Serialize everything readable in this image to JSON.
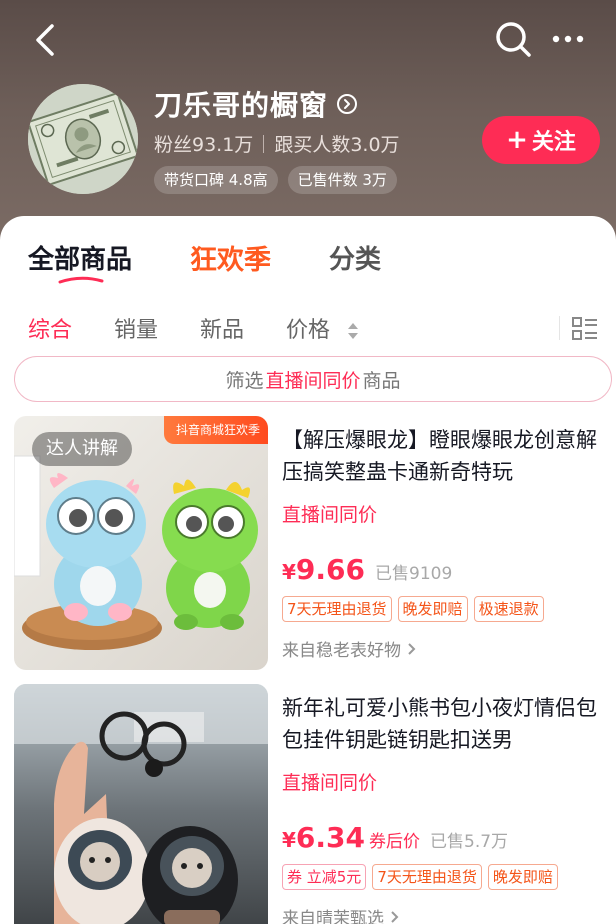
{
  "header": {
    "shop_name": "刀乐哥的橱窗",
    "fans": "粉丝93.1万",
    "followers_buy": "跟买人数3.0万",
    "rating_badge": "带货口碑 4.8高",
    "sold_badge": "已售件数 3万",
    "follow_label": "关注"
  },
  "tabs": {
    "all": "全部商品",
    "festival": "狂欢季",
    "category": "分类"
  },
  "sort": {
    "comprehensive": "综合",
    "sales": "销量",
    "new": "新品",
    "price": "价格"
  },
  "filter": {
    "prefix": "筛选",
    "highlight": "直播间同价",
    "suffix": "商品"
  },
  "products": [
    {
      "thumb_tag": "达人讲解",
      "festival_tag": "抖音商城狂欢季",
      "title": "【解压爆眼龙】瞪眼爆眼龙创意解压搞笑整蛊卡通新奇特玩",
      "live_price": "直播间同价",
      "yen": "¥",
      "price": "9.66",
      "sold": "已售9109",
      "tags": [
        "7天无理由退货",
        "晚发即赔",
        "极速退款"
      ],
      "source": "来自稳老表好物"
    },
    {
      "title": "新年礼可爱小熊书包小夜灯情侣包包挂件钥匙链钥匙扣送男",
      "live_price": "直播间同价",
      "yen": "¥",
      "price": "6.34",
      "after_coupon": "券后价",
      "sold": "已售5.7万",
      "coupon_tag": "券 立减5元",
      "tags": [
        "7天无理由退货",
        "晚发即赔"
      ],
      "source": "来自晴茉甄选"
    }
  ],
  "colors": {
    "accent": "#fe2c55",
    "festival": "#ff5a1f",
    "header_bg": "#6e5f59"
  },
  "icons": [
    "back-icon",
    "search-icon",
    "more-icon",
    "info-circle-icon",
    "list-layout-icon",
    "sort-arrows-icon",
    "chevron-right-icon"
  ]
}
